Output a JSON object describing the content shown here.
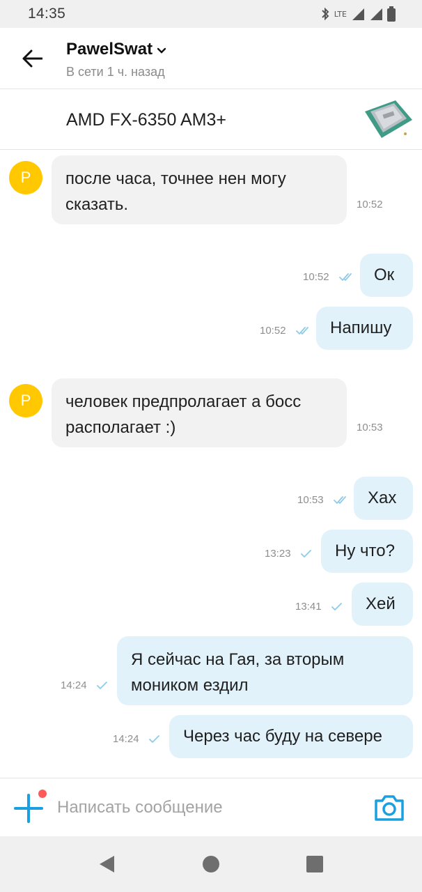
{
  "status_bar": {
    "time": "14:35",
    "network": "LTE"
  },
  "header": {
    "contact_name": "PawelSwat",
    "contact_status": "В сети 1 ч. назад"
  },
  "listing": {
    "title": "AMD FX-6350 AM3+"
  },
  "avatar_letter": "P",
  "messages": [
    {
      "direction": "in",
      "lines": [
        "после часа, точнее нен могу",
        "сказать."
      ],
      "time": "10:52"
    },
    {
      "direction": "out",
      "text": "Ок",
      "time": "10:52",
      "status": "read"
    },
    {
      "direction": "out",
      "text": "Напишу",
      "time": "10:52",
      "status": "read"
    },
    {
      "direction": "in",
      "lines": [
        "человек предпролагает а босс",
        "располагает :)"
      ],
      "time": "10:53"
    },
    {
      "direction": "out",
      "text": "Хах",
      "time": "10:53",
      "status": "read"
    },
    {
      "direction": "out",
      "text": "Ну что?",
      "time": "13:23",
      "status": "sent"
    },
    {
      "direction": "out",
      "text": "Хей",
      "time": "13:41",
      "status": "sent"
    },
    {
      "direction": "out",
      "lines": [
        "Я сейчас на Гая, за вторым",
        "моником ездил"
      ],
      "time": "14:24",
      "status": "sent"
    },
    {
      "direction": "out",
      "text": "Через час буду на севере",
      "time": "14:24",
      "status": "sent"
    }
  ],
  "composer": {
    "placeholder": "Написать сообщение"
  },
  "colors": {
    "accent": "#1a9fe0",
    "avatar": "#ffc800",
    "bubble_in": "#f2f2f2",
    "bubble_out": "#e2f2fb",
    "notification": "#ff5a5a"
  },
  "icons": {
    "back": "arrow-left-icon",
    "dropdown": "chevron-down-icon",
    "attach": "plus-icon",
    "camera": "camera-icon",
    "nav_back": "triangle-back-icon",
    "nav_home": "circle-home-icon",
    "nav_recents": "square-recents-icon"
  }
}
